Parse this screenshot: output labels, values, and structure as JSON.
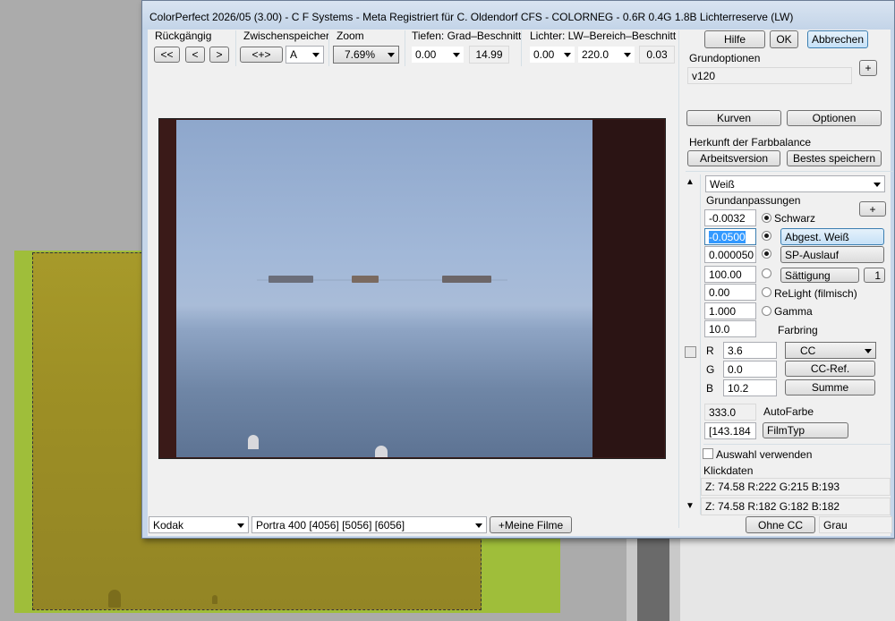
{
  "window": {
    "title": "ColorPerfect 2026/05 (3.00) - C F Systems -  Meta Registriert für C. Oldendorf CFS - COLORNEG - 0.6R 0.4G 1.8B Lichterreserve (LW)"
  },
  "toolbar": {
    "undo_label": "Rückgängig",
    "undo_btns": [
      "<<",
      "<",
      ">"
    ],
    "buffer_label": "Zwischenspeicher",
    "buffer_btn": "<+>",
    "buffer_slot": "A",
    "zoom_label": "Zoom",
    "zoom_value": "7.69%",
    "depth_label": "Tiefen: Grad–Beschnitt",
    "depth_value": "0.00",
    "depth_clip": "14.99",
    "lights_label": "Lichter: LW–Bereich–Beschnitt",
    "lights_value": "0.00",
    "lights_range": "220.0",
    "lights_clip": "0.03"
  },
  "buttons": {
    "help": "Hilfe",
    "ok": "OK",
    "cancel": "Abbrechen"
  },
  "basic": {
    "label": "Grundoptionen",
    "value": "v120",
    "plus": "+",
    "curves": "Kurven",
    "options": "Optionen",
    "origin_label": "Herkunft der Farbbalance",
    "work_version": "Arbeitsversion",
    "save_best": "Bestes speichern"
  },
  "adjust": {
    "preset": "Weiß",
    "section_label": "Grundanpassungen",
    "plus": "+",
    "black_value": "-0.0032",
    "black_label": "Schwarz",
    "white_value": "-0.0500",
    "white_btn": "Abgest. Weiß",
    "sp_value": "0.000050",
    "sp_btn": "SP-Auslauf",
    "sat_value": "100.00",
    "sat_btn": "Sättigung",
    "sat_num": "1",
    "relight_value": "0.00",
    "relight_label": "ReLight (filmisch)",
    "gamma_value": "1.000",
    "gamma_label": "Gamma",
    "ring_value": "10.0",
    "ring_label": "Farbring",
    "r_label": "R",
    "r_value": "3.6",
    "g_label": "G",
    "g_value": "0.0",
    "b_label": "B",
    "b_value": "10.2",
    "cc_select": "CC",
    "cc_ref": "CC-Ref.",
    "sum": "Summe",
    "auto_value": "333.0",
    "auto_label": "AutoFarbe",
    "filmtype_value": "[143.184",
    "filmtype_btn": "FilmTyp",
    "use_selection": "Auswahl verwenden",
    "click_label": "Klickdaten",
    "click_row1": "Z:  74.58  R:222 G:215 B:193",
    "click_row2": "Z:  74.58  R:182 G:182 B:182"
  },
  "bottom": {
    "maker": "Kodak",
    "film": "Portra 400 [4056] [5056] [6056]",
    "my_films": "+Meine Filme",
    "no_cc": "Ohne CC",
    "gray": "Grau"
  }
}
